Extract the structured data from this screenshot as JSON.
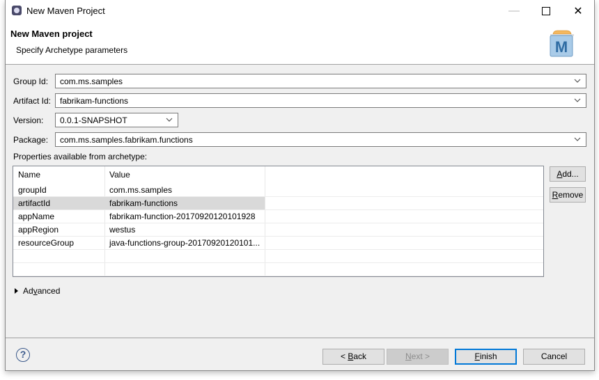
{
  "window": {
    "title": "New Maven Project",
    "controls": {
      "minimize": "—",
      "close": "✕"
    }
  },
  "header": {
    "title": "New Maven project",
    "subtitle": "Specify Archetype parameters",
    "logo_letter": "M"
  },
  "form": {
    "group_id": {
      "label": "Group Id:",
      "value": "com.ms.samples"
    },
    "artifact_id": {
      "label": "Artifact Id:",
      "value": "fabrikam-functions"
    },
    "version": {
      "label": "Version:",
      "value": "0.0.1-SNAPSHOT"
    },
    "package": {
      "label": "Package:",
      "value": "com.ms.samples.fabrikam.functions"
    }
  },
  "properties": {
    "label": "Properties available from archetype:",
    "columns": [
      "Name",
      "Value"
    ],
    "rows": [
      {
        "name": "groupId",
        "value": "com.ms.samples"
      },
      {
        "name": "artifactId",
        "value": "fabrikam-functions",
        "selected": true
      },
      {
        "name": "appName",
        "value": "fabrikam-function-20170920120101928"
      },
      {
        "name": "appRegion",
        "value": "westus"
      },
      {
        "name": "resourceGroup",
        "value": "java-functions-group-20170920120101..."
      }
    ],
    "add_button": {
      "mnemonic": "A",
      "rest": "dd..."
    },
    "remove_button": {
      "mnemonic": "R",
      "rest": "emove"
    }
  },
  "advanced": {
    "pre": "Ad",
    "mnemonic": "v",
    "post": "anced"
  },
  "footer": {
    "help": "?",
    "back": {
      "pre": "< ",
      "mnemonic": "B",
      "post": "ack"
    },
    "next": {
      "pre": "",
      "mnemonic": "N",
      "post": "ext >",
      "disabled": true
    },
    "finish": {
      "pre": "",
      "mnemonic": "F",
      "post": "inish"
    },
    "cancel": "Cancel"
  }
}
